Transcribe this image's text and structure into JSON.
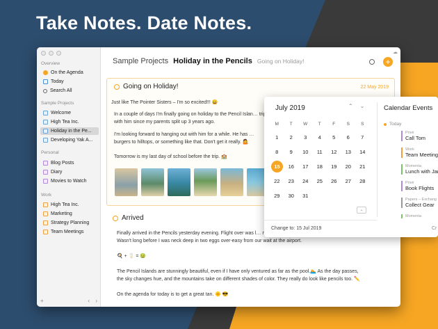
{
  "headline": "Take Notes. Date Notes.",
  "sidebar": {
    "sections": [
      {
        "label": "Overview",
        "items": [
          {
            "label": "On the Agenda",
            "icon": "agenda-dot-icon"
          },
          {
            "label": "Today",
            "icon": "calendar-icon"
          },
          {
            "label": "Search All",
            "icon": "search-icon"
          }
        ]
      },
      {
        "label": "Sample Projects",
        "items": [
          {
            "label": "Welcome",
            "icon": "note-icon"
          },
          {
            "label": "High Tea Inc.",
            "icon": "note-icon"
          },
          {
            "label": "Holiday in the Pe...",
            "icon": "note-icon"
          },
          {
            "label": "Developing Yak A...",
            "icon": "note-icon"
          }
        ]
      },
      {
        "label": "Personal",
        "items": [
          {
            "label": "Blog Posts",
            "icon": "note-icon"
          },
          {
            "label": "Diary",
            "icon": "note-icon"
          },
          {
            "label": "Movies to Watch",
            "icon": "note-icon"
          }
        ]
      },
      {
        "label": "Work",
        "items": [
          {
            "label": "High Tea Inc.",
            "icon": "note-icon"
          },
          {
            "label": "Marketing",
            "icon": "note-icon"
          },
          {
            "label": "Strategy Planning",
            "icon": "note-icon"
          },
          {
            "label": "Team Meetings",
            "icon": "note-icon"
          }
        ]
      }
    ],
    "footer": {
      "add": "+",
      "back": "‹",
      "forward": "›"
    }
  },
  "main": {
    "project": "Sample Projects",
    "note_title": "Holiday in the Pencils",
    "note_subtitle": "Going on Holiday!",
    "add_label": "+"
  },
  "entry1": {
    "title": "Going on Holiday!",
    "date": "22 May 2019",
    "paragraphs": [
      "Just like The Pointer Sisters – I'm so excited!!! 😀",
      "In a couple of days I'm finally going on holiday to the Pencil Islan… trip with him since my parents split up 3 years ago.",
      "I'm looking forward to hanging out with him for a while. He has … burgers to hilltops, or something like that. Don't get it really. 🤷",
      "Tomorrow is my last day of school before the trip. 🏫"
    ]
  },
  "entry2": {
    "title": "Arrived",
    "paragraphs": [
      "Finally arrived in the Pencils yesterday evening. Flight over was l… makes for some pretty rocky turbulence. Wasn't long before I was neck deep in two eggs over-easy from our wait at the airport.",
      "🍳 + 🥛 = 🤢",
      "The Pencil Islands are stunningly beautiful, even if I have only ventured as far as the pool.🏊 As the day passes, the sky changes hue, and the mountains take on different shades of color. They really do look like pencils too. ✏️",
      "On the agenda for today is to get a great tan. 🌞 😎"
    ]
  },
  "popover": {
    "month": "July 2019",
    "prev": "⌃",
    "next": "⌄",
    "weekdays": [
      "M",
      "T",
      "W",
      "T",
      "F",
      "S",
      "S"
    ],
    "days": [
      "1",
      "2",
      "3",
      "4",
      "5",
      "6",
      "7",
      "8",
      "9",
      "10",
      "11",
      "12",
      "13",
      "14",
      "15",
      "16",
      "17",
      "18",
      "19",
      "20",
      "21",
      "22",
      "23",
      "24",
      "25",
      "26",
      "27",
      "28",
      "29",
      "30",
      "31"
    ],
    "selected_day": "15",
    "change_to": "Change to: 15 Jul 2019",
    "expand": "⌄",
    "events_title": "Calendar Events",
    "today_label": "Today",
    "events": [
      {
        "cal": "Privé",
        "title": "Call Tom",
        "color": "#b18ad6"
      },
      {
        "cal": "Work",
        "title": "Team Meeting",
        "color": "#f0a040"
      },
      {
        "cal": "Momenta",
        "title": "Lunch with Jan",
        "color": "#7cc36a"
      },
      {
        "cal": "Privé",
        "title": "Book Flights",
        "color": "#b18ad6"
      },
      {
        "cal": "Papers – Exchang",
        "title": "Collect Gear",
        "color": "#999999"
      },
      {
        "cal": "Momenta",
        "title": "",
        "color": "#7cc36a"
      }
    ],
    "right_cut_label": "Cr"
  }
}
